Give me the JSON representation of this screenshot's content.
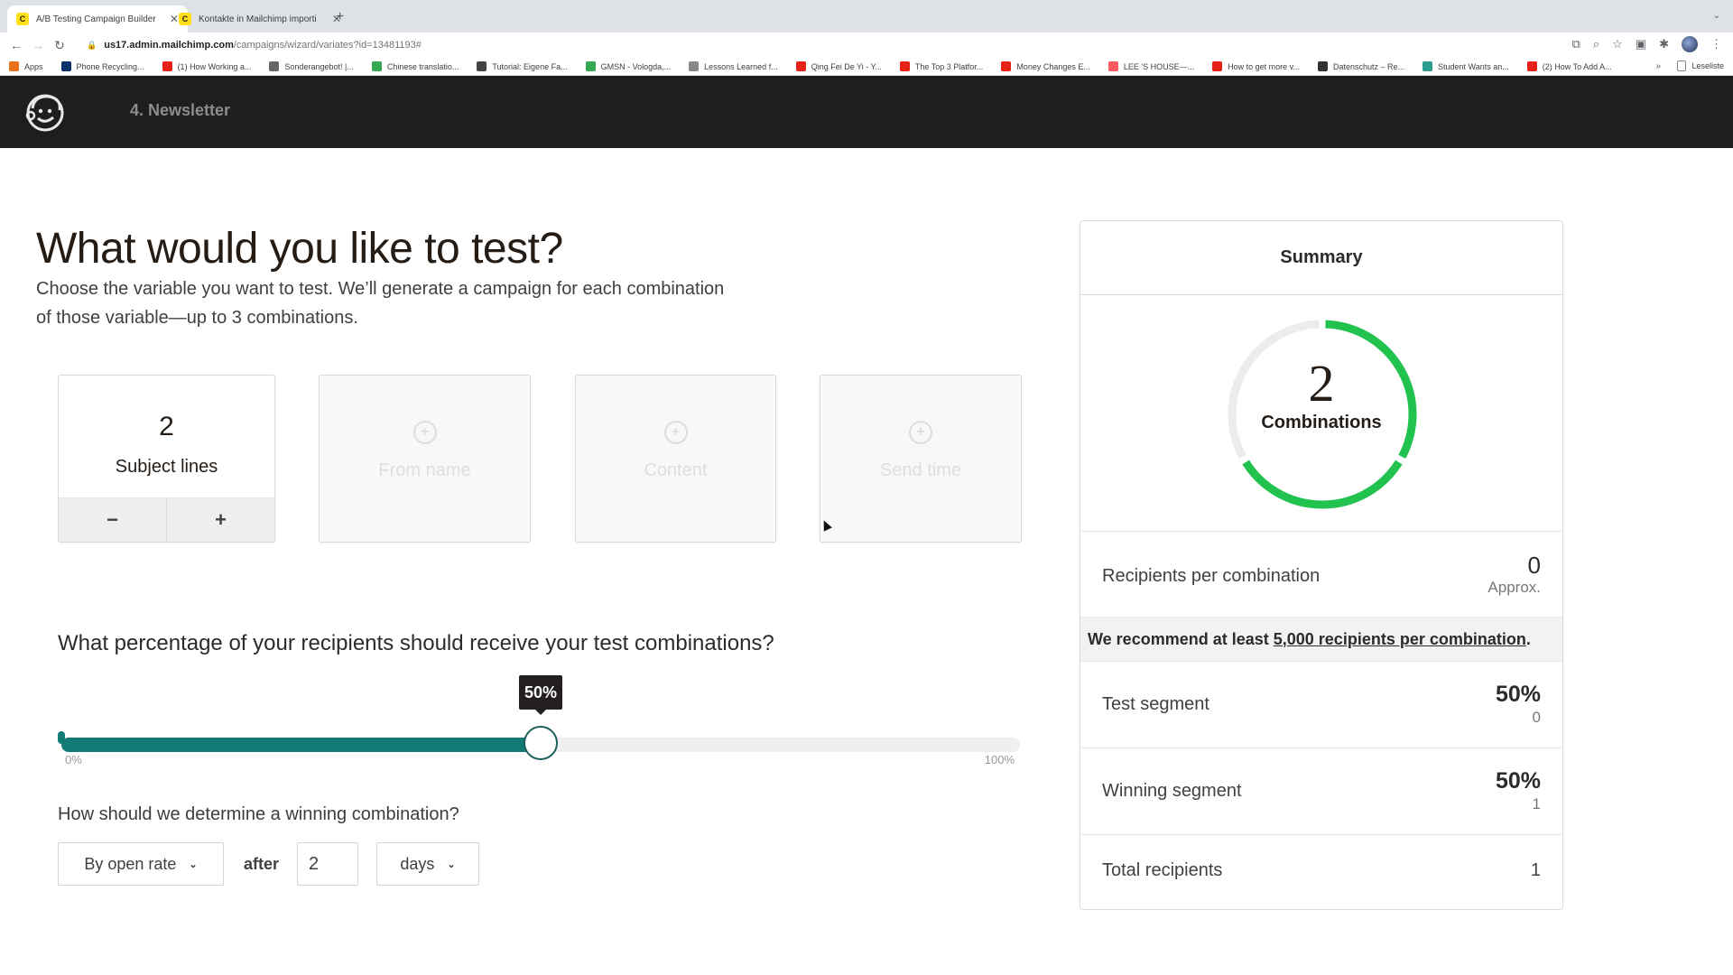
{
  "browser": {
    "tabs": [
      {
        "title": "A/B Testing Campaign Builder",
        "active": true
      },
      {
        "title": "Kontakte in Mailchimp importi",
        "active": false
      }
    ],
    "new_tab_label": "+",
    "url_host": "us17.admin.mailchimp.com",
    "url_path": "/campaigns/wizard/variates?id=13481193#",
    "bookmarks": [
      {
        "label": "Apps",
        "color": "#e8711a"
      },
      {
        "label": "Phone Recycling...",
        "color": "#0b2f6a"
      },
      {
        "label": "(1) How Working a...",
        "color": "#e62117"
      },
      {
        "label": "Sonderangebot! |...",
        "color": "#666666"
      },
      {
        "label": "Chinese translatio...",
        "color": "#34a853"
      },
      {
        "label": "Tutorial: Eigene Fa...",
        "color": "#444444"
      },
      {
        "label": "GMSN - Vologda,...",
        "color": "#34a853"
      },
      {
        "label": "Lessons Learned f...",
        "color": "#888888"
      },
      {
        "label": "Qing Fei De Yi - Y...",
        "color": "#e62117"
      },
      {
        "label": "The Top 3 Platfor...",
        "color": "#e62117"
      },
      {
        "label": "Money Changes E...",
        "color": "#e62117"
      },
      {
        "label": "LEE 'S HOUSE—...",
        "color": "#ff5a5f"
      },
      {
        "label": "How to get more v...",
        "color": "#e62117"
      },
      {
        "label": "Datenschutz – Re...",
        "color": "#333333"
      },
      {
        "label": "Student Wants an...",
        "color": "#2a9d8f"
      },
      {
        "label": "(2) How To Add A...",
        "color": "#e62117"
      }
    ],
    "bookmarks_more": "»",
    "reading_list": "Leseliste"
  },
  "app": {
    "campaign_name": "4. Newsletter"
  },
  "main": {
    "title": "What would you like to test?",
    "description": "Choose the variable you want to test. We’ll generate a campaign for each combination of those variable—up to 3 combinations.",
    "variables": [
      {
        "label": "Subject lines",
        "count": "2",
        "active": true,
        "decrement_label": "−",
        "increment_label": "+"
      },
      {
        "label": "From name",
        "active": false
      },
      {
        "label": "Content",
        "active": false
      },
      {
        "label": "Send time",
        "active": false
      }
    ],
    "percentage_question": "What percentage of your recipients should receive your test combinations?",
    "slider": {
      "value_percent": 50,
      "tooltip": "50%",
      "min_label": "0%",
      "max_label": "100%",
      "fill_color": "#127b76"
    },
    "winner_question": "How should we determine a winning combination?",
    "winner_metric": "By open rate",
    "after_label": "after",
    "duration_value": "2",
    "duration_unit": "days"
  },
  "summary": {
    "title": "Summary",
    "combinations": "2",
    "combinations_label": "Combinations",
    "ring": {
      "filled": 2,
      "total": 3,
      "fill_color": "#22c24f",
      "empty_color": "#ececec"
    },
    "recipients_per_combination_label": "Recipients per combination",
    "recipients_per_combination_value": "0",
    "recipients_per_combination_sub": "Approx.",
    "recommend_prefix": "We recommend at least",
    "recommend_link": "5,000 recipients per combination",
    "recommend_suffix": ".",
    "test_segment_label": "Test segment",
    "test_segment_value": "50%",
    "test_segment_count": "0",
    "winning_segment_label": "Winning segment",
    "winning_segment_value": "50%",
    "winning_segment_count": "1",
    "total_recipients_label": "Total recipients",
    "total_recipients_value": "1"
  }
}
